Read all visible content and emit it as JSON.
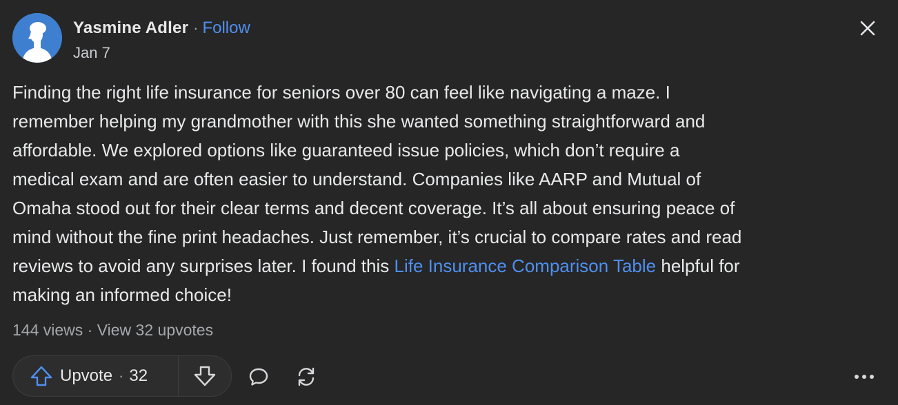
{
  "post": {
    "author": {
      "name": "Yasmine Adler",
      "separator": "·",
      "follow_label": "Follow"
    },
    "date": "Jan 7",
    "body_lines": [
      "Finding the right life insurance for seniors over 80 can feel like navigating a maze. I",
      "remember helping my grandmother with this she wanted something straightforward and",
      "affordable. We explored options like guaranteed issue policies, which don’t require a",
      "medical exam and are often easier to understand. Companies like AARP and Mutual of",
      "Omaha stood out for their clear terms and decent coverage. It’s all about ensuring peace of",
      "mind without the fine print headaches. Just remember, it’s crucial to compare rates and read"
    ],
    "body_line7_before": "reviews to avoid any surprises later. I found this ",
    "body_link_text": "Life Insurance Comparison Table",
    "body_line7_after": " helpful for",
    "body_line8": "making an informed choice!",
    "stats": {
      "views": "144 views",
      "separator": "·",
      "upvotes_link": "View 32 upvotes"
    },
    "actions": {
      "upvote_label": "Upvote",
      "upvote_separator": "·",
      "upvote_count": "32",
      "icons": {
        "upvote": "arrow-up-icon",
        "downvote": "arrow-down-icon",
        "comment": "comment-bubble-icon",
        "share": "repost-icon",
        "more": "more-horizontal-icon",
        "close": "close-icon"
      }
    }
  },
  "colors": {
    "background": "#262626",
    "text_primary": "#e8e9eb",
    "text_secondary": "#a5a8ad",
    "link": "#4f8ff0",
    "avatar_bg": "#3f7fcf"
  }
}
